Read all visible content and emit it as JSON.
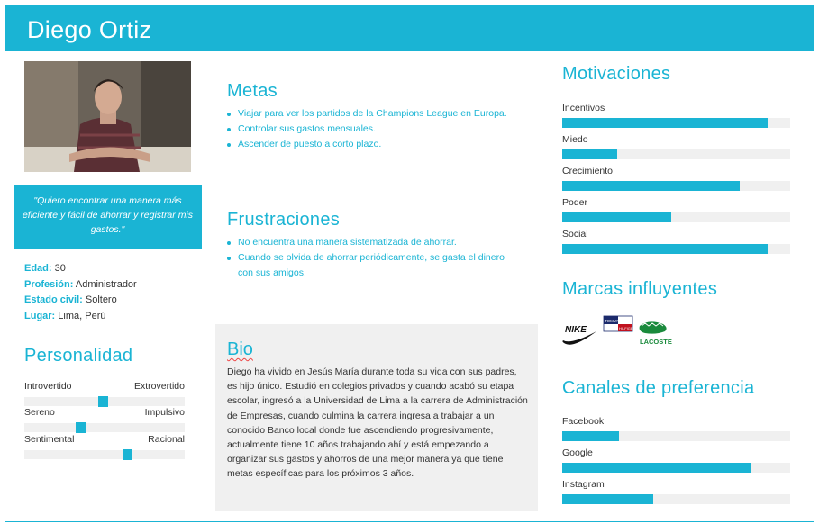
{
  "persona": {
    "name": "Diego Ortiz",
    "quote": "\"Quiero encontrar una manera más eficiente y fácil de ahorrar y registrar mis gastos.\""
  },
  "facts": [
    {
      "key": "Edad:",
      "value": "30"
    },
    {
      "key": "Profesión:",
      "value": "Administrador"
    },
    {
      "key": "Estado civil:",
      "value": "Soltero"
    },
    {
      "key": "Lugar:",
      "value": "Lima, Perú"
    }
  ],
  "personality": {
    "title": "Personalidad",
    "sliders": [
      {
        "left": "Introvertido",
        "right": "Extrovertido",
        "value": 0.49
      },
      {
        "left": "Sereno",
        "right": "Impulsivo",
        "value": 0.34
      },
      {
        "left": "Sentimental",
        "right": "Racional",
        "value": 0.65
      }
    ]
  },
  "goals": {
    "title": "Metas",
    "items": [
      "Viajar para ver los partidos de la Champions League en Europa.",
      "Controlar sus gastos mensuales.",
      "Ascender de puesto a corto plazo."
    ]
  },
  "frustrations": {
    "title": "Frustraciones",
    "items": [
      "No encuentra una manera sistematizada de ahorrar.",
      "Cuando se olvida de ahorrar periódicamente, se gasta el dinero con sus amigos."
    ]
  },
  "bio": {
    "title": "Bio",
    "text": "Diego ha vivido en Jesús María durante toda su vida con sus padres, es hijo único. Estudió en colegios privados y cuando acabó su etapa escolar, ingresó a la Universidad de Lima a la carrera de Administración de Empresas, cuando culmina la carrera ingresa a trabajar a un conocido Banco local donde fue ascendiendo progresivamente, actualmente tiene 10 años trabajando ahí y está empezando a organizar sus gastos y ahorros de una mejor manera ya que tiene metas específicas para los próximos 3 años."
  },
  "motivations": {
    "title": "Motivaciones",
    "items": [
      {
        "label": "Incentivos",
        "value": 0.9
      },
      {
        "label": "Miedo",
        "value": 0.24
      },
      {
        "label": "Crecimiento",
        "value": 0.78
      },
      {
        "label": "Poder",
        "value": 0.48
      },
      {
        "label": "Social",
        "value": 0.9
      }
    ]
  },
  "brands": {
    "title": "Marcas influyentes",
    "logos": [
      "NIKE",
      "TOMMY HILFIGER",
      "LACOSTE"
    ]
  },
  "channels": {
    "title": "Canales de preferencia",
    "items": [
      {
        "label": "Facebook",
        "value": 0.25
      },
      {
        "label": "Google",
        "value": 0.83
      },
      {
        "label": "Instagram",
        "value": 0.4
      }
    ]
  },
  "colors": {
    "accent": "#1ab4d4",
    "panel": "#f0f0f0"
  }
}
